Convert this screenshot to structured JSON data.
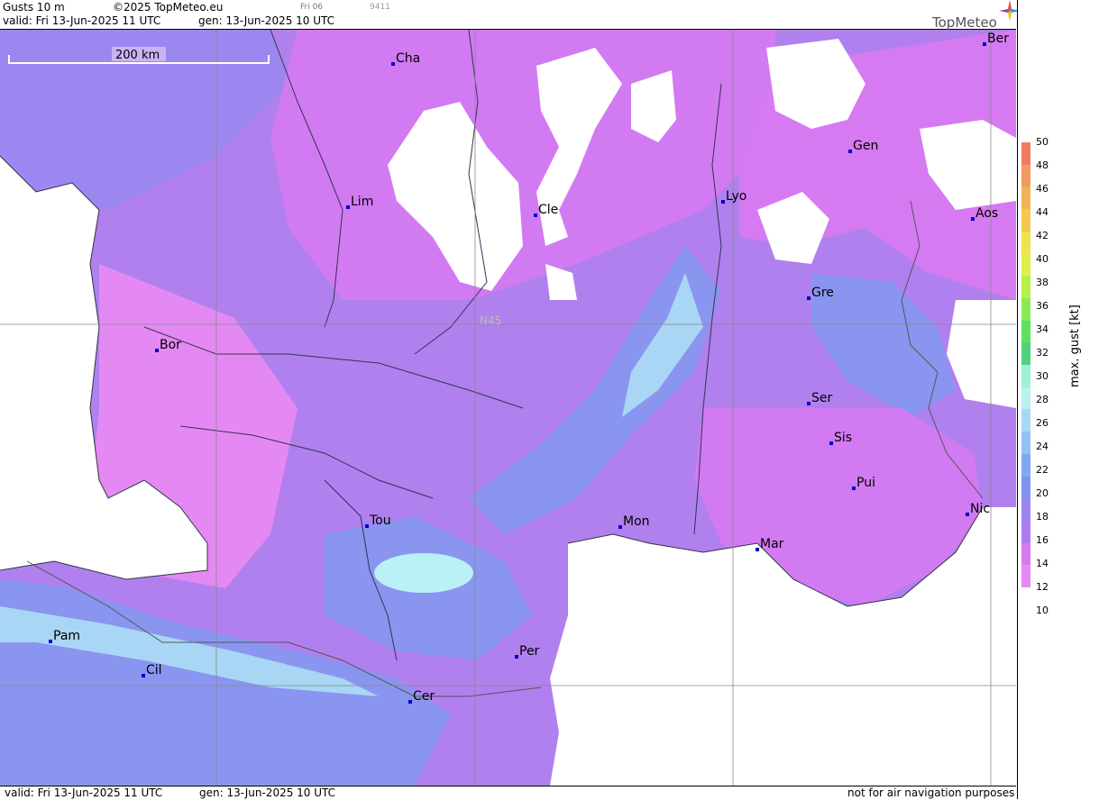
{
  "header": {
    "product": "Gusts 10 m",
    "copyright": "©2025 TopMeteo.eu",
    "valid": "valid:  Fri  13-Jun-2025  11 UTC",
    "generated": "gen: 13-Jun-2025 10 UTC",
    "run": "Fri 06",
    "code": "9411",
    "brand": "TopMeteo"
  },
  "footer": {
    "valid": "valid:  Fri  13-Jun-2025  11 UTC",
    "generated": "gen: 13-Jun-2025 10 UTC",
    "disclaimer": "not for air navigation purposes"
  },
  "map": {
    "scale_label": "200 km",
    "latitude_label": "N45",
    "cities": [
      {
        "name": "Cha"
      },
      {
        "name": "Ber"
      },
      {
        "name": "Gen"
      },
      {
        "name": "Lim"
      },
      {
        "name": "Cle"
      },
      {
        "name": "Lyo"
      },
      {
        "name": "Aos"
      },
      {
        "name": "Gre"
      },
      {
        "name": "Bor"
      },
      {
        "name": "Ser"
      },
      {
        "name": "Sis"
      },
      {
        "name": "Pui"
      },
      {
        "name": "Tou"
      },
      {
        "name": "Mon"
      },
      {
        "name": "Mar"
      },
      {
        "name": "Nic"
      },
      {
        "name": "Pam"
      },
      {
        "name": "Per"
      },
      {
        "name": "Cil"
      },
      {
        "name": "Cer"
      }
    ]
  },
  "legend": {
    "title": "max. gust [kt]",
    "ticks": [
      "50",
      "48",
      "46",
      "44",
      "42",
      "40",
      "38",
      "36",
      "34",
      "32",
      "30",
      "28",
      "26",
      "24",
      "22",
      "20",
      "18",
      "16",
      "14",
      "12",
      "10"
    ],
    "colors": [
      "#f27a63",
      "#f29a5e",
      "#f2b356",
      "#f2c94c",
      "#f0e24d",
      "#dff04a",
      "#b7ef4c",
      "#8aea52",
      "#5fe05f",
      "#4fd27a",
      "#9ff0d6",
      "#b9f0f2",
      "#a9d9f2",
      "#93c2f2",
      "#7fa8f2",
      "#7f93f0",
      "#9a86f0",
      "#b37af0",
      "#d67af2",
      "#e48af5"
    ],
    "palette": {
      "water": "#ffffff",
      "level_12": "#e489f3",
      "level_14": "#d27af2",
      "level_16": "#b57cf0",
      "level_18": "#9c86ef",
      "level_20": "#8a95f0",
      "level_22": "#7fa7f2",
      "level_24": "#a9d6f4",
      "level_26": "#b9f1f7"
    }
  }
}
